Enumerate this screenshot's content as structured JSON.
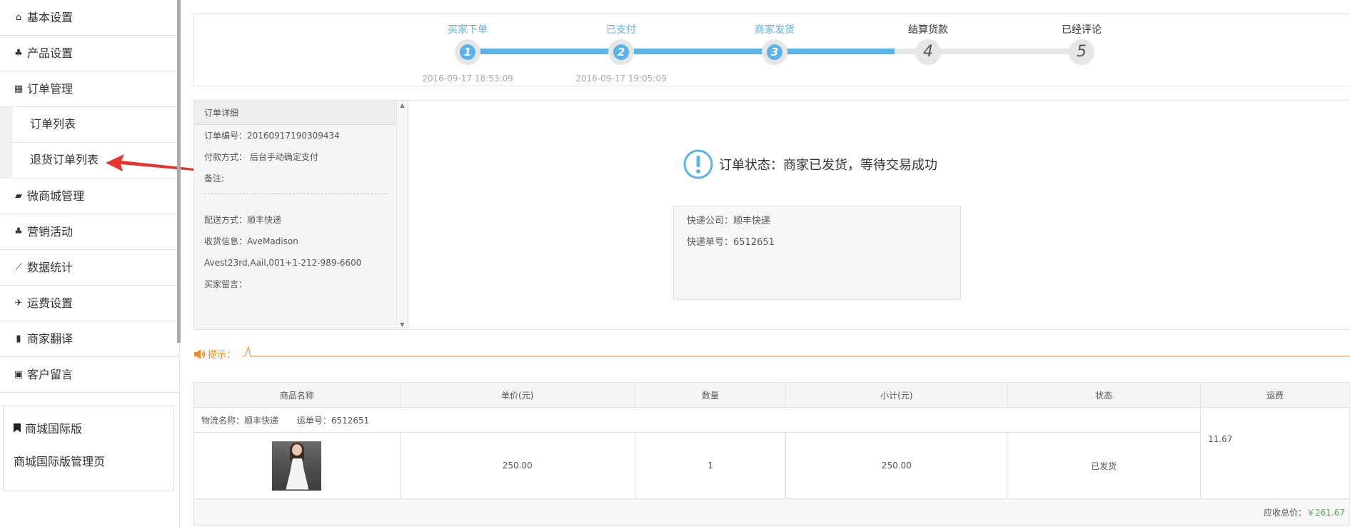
{
  "sidebar": {
    "items": [
      {
        "icon": "home-icon",
        "glyph": "⌂",
        "label": "基本设置"
      },
      {
        "icon": "gift-icon",
        "glyph": "♣",
        "label": "产品设置"
      },
      {
        "icon": "calendar-icon",
        "glyph": "▦",
        "label": "订单管理"
      }
    ],
    "subitems": [
      {
        "label": "订单列表"
      },
      {
        "label": "退货订单列表"
      }
    ],
    "items2": [
      {
        "icon": "shopping-bag-icon",
        "glyph": "▰",
        "label": "微商城管理"
      },
      {
        "icon": "gift-icon",
        "glyph": "♣",
        "label": "营销活动"
      },
      {
        "icon": "chart-icon",
        "glyph": "⟋",
        "label": "数据统计"
      },
      {
        "icon": "plane-icon",
        "glyph": "✈",
        "label": "运费设置"
      },
      {
        "icon": "book-icon",
        "glyph": "▮",
        "label": "商家翻译"
      },
      {
        "icon": "document-icon",
        "glyph": "▣",
        "label": "客户留言"
      }
    ],
    "intl": {
      "title": "商城国际版",
      "link": "商城国际版管理页"
    }
  },
  "steps": [
    {
      "label": "买家下单",
      "num": "1",
      "time": "2016-09-17 18:53:09",
      "state": "done"
    },
    {
      "label": "已支付",
      "num": "2",
      "time": "2016-09-17 19:05:09",
      "state": "done"
    },
    {
      "label": "商家发货",
      "num": "3",
      "time": "",
      "state": "done"
    },
    {
      "label": "结算货款",
      "num": "4",
      "time": "",
      "state": "todo"
    },
    {
      "label": "已经评论",
      "num": "5",
      "time": "",
      "state": "todo"
    }
  ],
  "progress_fraction": 0.69,
  "detail": {
    "title": "订单详细",
    "order_no": "订单编号：20160917190309434",
    "pay_method": "付款方式： 后台手动确定支付",
    "remark": "备注:",
    "ship_method": "配送方式：顺丰快递",
    "receiver": "收货信息：AveMadison",
    "address": "Avest23rd,Aail,001+1-212-989-6600",
    "buyer_msg": "买家留言："
  },
  "status": {
    "text": "订单状态：商家已发货，等待交易成功",
    "courier": "快递公司：顺丰快递",
    "tracking": "快递单号：6512651"
  },
  "tip": {
    "label": "提示："
  },
  "table": {
    "headers": [
      "商品名称",
      "单价(元)",
      "数量",
      "小计(元)",
      "状态",
      "运费"
    ],
    "logistics_name": "物流名称：顺丰快递",
    "waybill": "运单号：6512651",
    "row": {
      "price": "250.00",
      "qty": "1",
      "subtotal": "250.00",
      "status": "已发货",
      "freight": "11.67"
    },
    "total_label": "应收总价：",
    "total_value": "￥261.67"
  },
  "colors": {
    "accent": "#5ab4e9",
    "tip": "#f08a24",
    "arrow": "#e8322d",
    "total": "#4cae4c"
  }
}
